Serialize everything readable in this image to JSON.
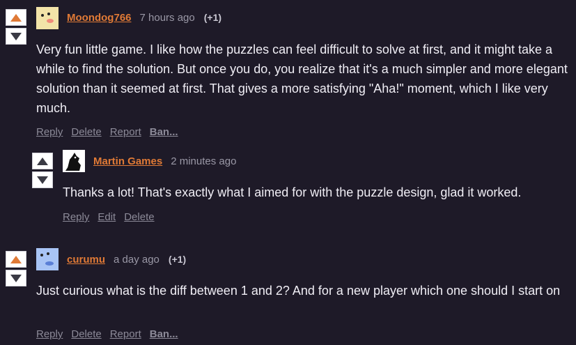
{
  "comments": [
    {
      "author": "Moondog766",
      "time": "7 hours ago",
      "score": "(+1)",
      "text": "Very fun little game. I like how the puzzles can feel difficult to solve at first, and it might take a while to find the solution. But once you do, you realize that it's a much simpler and more elegant solution than it seemed at first. That gives a more satisfying \"Aha!\" moment, which I like very much.",
      "upvoted": true,
      "actions": [
        "Reply",
        "Delete",
        "Report",
        "Ban..."
      ],
      "avatar_color": "#f2e3a8"
    },
    {
      "author": "Martin Games",
      "time": "2 minutes ago",
      "text": "Thanks a lot! That's exactly what I aimed for with the puzzle design, glad it worked.",
      "upvoted": false,
      "actions": [
        "Reply",
        "Edit",
        "Delete"
      ],
      "avatar_color": "#ffffff"
    },
    {
      "author": "curumu",
      "time": "a day ago",
      "score": "(+1)",
      "text": "Just curious what is the diff between 1 and 2? And for a new player which one should I start on",
      "upvoted": true,
      "actions": [
        "Reply",
        "Delete",
        "Report",
        "Ban..."
      ],
      "avatar_color": "#a8c4f5"
    }
  ],
  "colors": {
    "accent": "#e07a36",
    "background": "#1e1a28"
  }
}
